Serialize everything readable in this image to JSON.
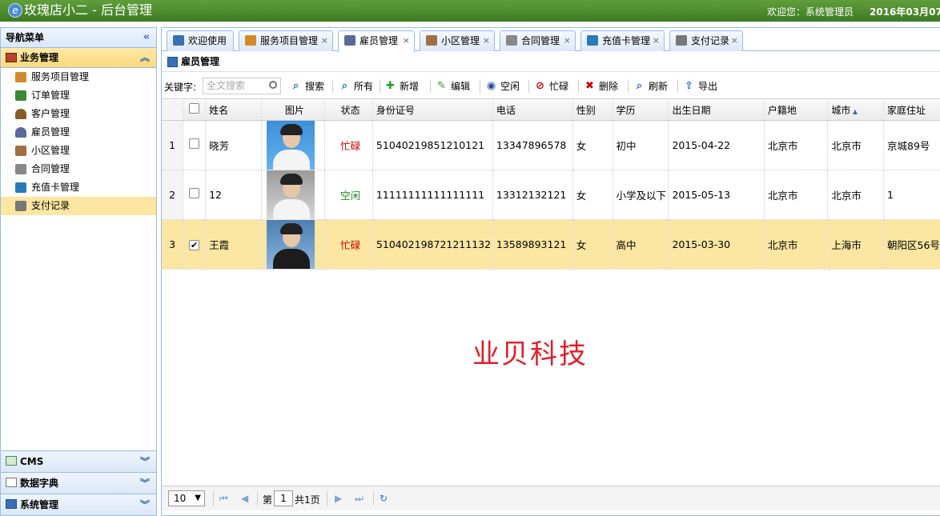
{
  "app": {
    "title": "玫瑰店小二 - 后台管理",
    "welcome": "欢迎您：系统管理员",
    "date": "2016年03月07"
  },
  "nav": {
    "title": "导航菜单",
    "groups": [
      {
        "label": "业务管理",
        "items": [
          "服务项目管理",
          "订单管理",
          "客户管理",
          "雇员管理",
          "小区管理",
          "合同管理",
          "充值卡管理",
          "支付记录"
        ]
      },
      {
        "label": "CMS"
      },
      {
        "label": "数据字典"
      },
      {
        "label": "系统管理"
      }
    ]
  },
  "tabs": [
    "欢迎使用",
    "服务项目管理",
    "雇员管理",
    "小区管理",
    "合同管理",
    "充值卡管理",
    "支付记录"
  ],
  "grid": {
    "title": "雇员管理",
    "keyword_label": "关键字:",
    "search_placeholder": "全文搜索",
    "buttons": [
      "搜索",
      "所有",
      "新增",
      "编辑",
      "空闲",
      "忙碌",
      "删除",
      "刷新",
      "导出"
    ],
    "columns": [
      "姓名",
      "图片",
      "状态",
      "身份证号",
      "电话",
      "性别",
      "学历",
      "出生日期",
      "户籍地",
      "城市",
      "家庭住址"
    ],
    "rows": [
      {
        "num": "1",
        "checked": false,
        "name": "晓芳",
        "status": "忙碌",
        "id": "51040219851210121",
        "phone": "13347896578",
        "gender": "女",
        "edu": "初中",
        "birth": "2015-04-22",
        "hukou": "北京市",
        "city": "北京市",
        "address": "京城89号"
      },
      {
        "num": "2",
        "checked": false,
        "name": "12",
        "status": "空闲",
        "id": "11111111111111111",
        "phone": "13312132121",
        "gender": "女",
        "edu": "小学及以下",
        "birth": "2015-05-13",
        "hukou": "北京市",
        "city": "北京市",
        "address": "1"
      },
      {
        "num": "3",
        "checked": true,
        "name": "王霞",
        "status": "忙碌",
        "id": "510402198721211132",
        "phone": "13589893121",
        "gender": "女",
        "edu": "高中",
        "birth": "2015-03-30",
        "hukou": "北京市",
        "city": "上海市",
        "address": "朝阳区56号"
      }
    ]
  },
  "watermark": "业贝科技",
  "pager": {
    "page_size": "10",
    "page_prefix": "第",
    "page_num": "1",
    "page_total": "共1页"
  }
}
